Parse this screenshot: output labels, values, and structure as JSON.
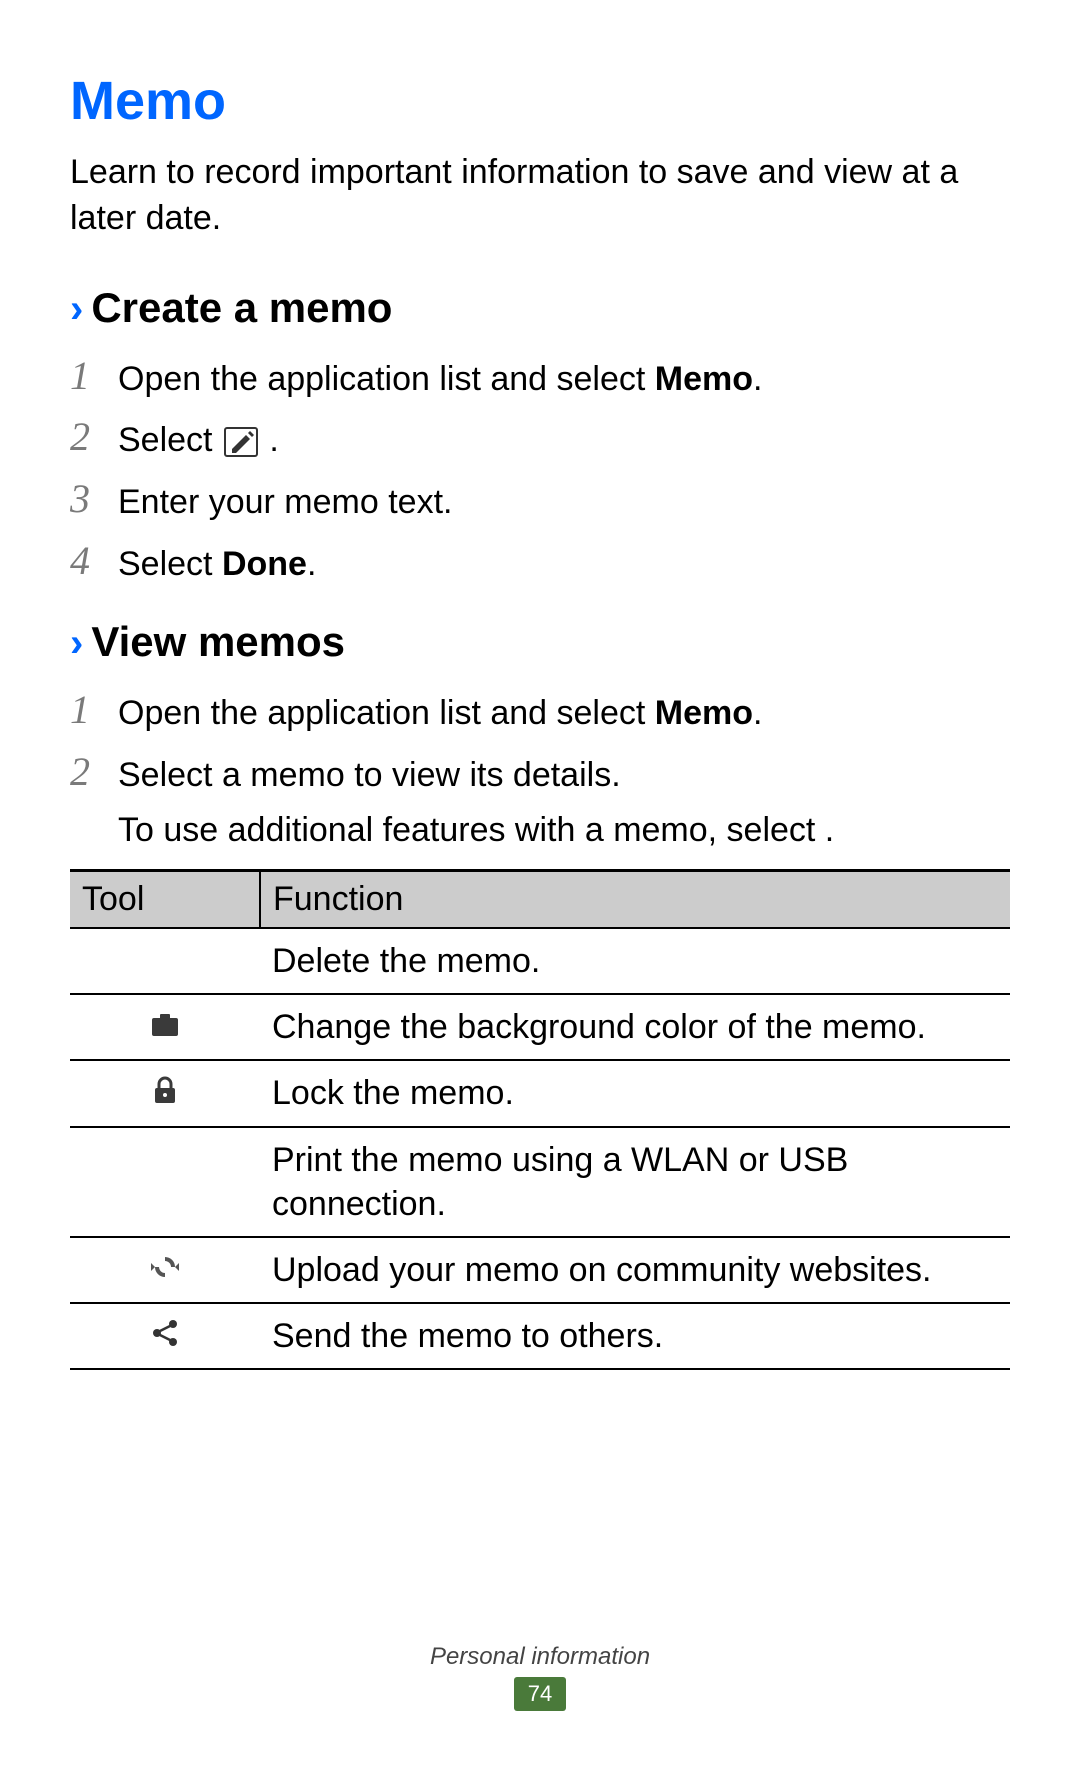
{
  "title": "Memo",
  "intro": "Learn to record important information to save and view at a later date.",
  "sections": {
    "create": {
      "title": "Create a memo",
      "steps": {
        "s1": {
          "num": "1",
          "pre": "Open the application list and select ",
          "bold": "Memo",
          "post": "."
        },
        "s2": {
          "num": "2",
          "pre": "Select ",
          "post": "."
        },
        "s3": {
          "num": "3",
          "text": "Enter your memo text."
        },
        "s4": {
          "num": "4",
          "pre": "Select ",
          "bold": "Done",
          "post": "."
        }
      }
    },
    "view": {
      "title": "View memos",
      "steps": {
        "s1": {
          "num": "1",
          "pre": "Open the application list and select ",
          "bold": "Memo",
          "post": "."
        },
        "s2": {
          "num": "2",
          "text": "Select a memo to view its details.",
          "sub": "To use additional features with a memo, select     ."
        }
      }
    }
  },
  "table": {
    "headers": {
      "tool": "Tool",
      "func": "Function"
    },
    "rows": {
      "r1": {
        "func": "Delete the memo."
      },
      "r2": {
        "func": "Change the background color of the memo."
      },
      "r3": {
        "func": "Lock the memo."
      },
      "r4": {
        "func": "Print the memo using a WLAN or USB connection."
      },
      "r5": {
        "func": "Upload your memo on community websites."
      },
      "r6": {
        "func": "Send the memo to others."
      }
    }
  },
  "footer": {
    "section": "Personal information",
    "page": "74"
  }
}
